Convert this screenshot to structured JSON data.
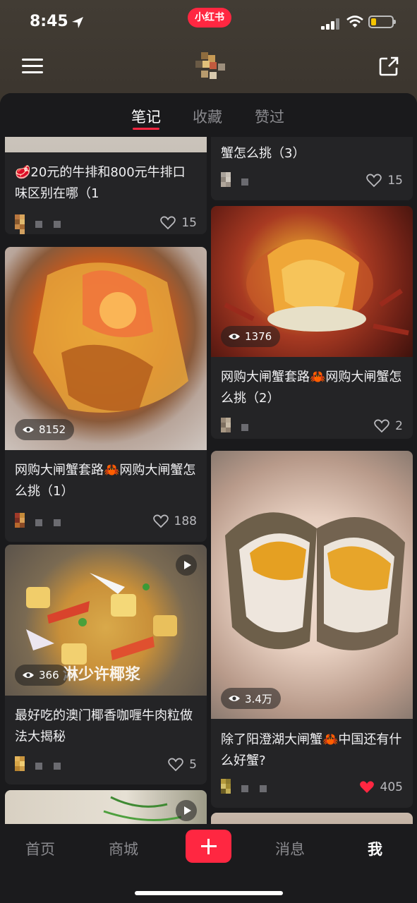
{
  "status_bar": {
    "time": "8:45",
    "app_badge": "小红书"
  },
  "tabs": [
    {
      "label": "笔记",
      "active": true
    },
    {
      "label": "收藏",
      "active": false
    },
    {
      "label": "赞过",
      "active": false
    }
  ],
  "feed": {
    "left": [
      {
        "title": "🥩20元的牛排和800元牛排口味区别在哪（1",
        "likes": "15",
        "liked": false
      },
      {
        "title": "网购大闸蟹套路🦀网购大闸蟹怎么挑（1）",
        "views": "8152",
        "likes": "188",
        "liked": false
      },
      {
        "title": "最好吃的澳门椰香咖喱牛肉粒做法大揭秘",
        "views": "366",
        "overlay_text": "淋少许椰浆",
        "likes": "5",
        "liked": false,
        "video": true
      },
      {
        "title": "",
        "likes": "",
        "video": true
      }
    ],
    "right": [
      {
        "title": "蟹怎么挑（3）",
        "likes": "15",
        "liked": false
      },
      {
        "title": "网购大闸蟹套路🦀网购大闸蟹怎么挑（2）",
        "views": "1376",
        "likes": "2",
        "liked": false
      },
      {
        "title": "除了阳澄湖大闸蟹🦀中国还有什么好蟹?",
        "views": "3.4万",
        "likes": "405",
        "liked": true
      },
      {
        "title": "",
        "likes": ""
      }
    ]
  },
  "bottom_nav": [
    {
      "label": "首页",
      "active": false
    },
    {
      "label": "商城",
      "active": false
    },
    {
      "label": "消息",
      "active": false
    },
    {
      "label": "我",
      "active": true
    }
  ],
  "colors": {
    "accent": "#ff2741",
    "background": "#1a1a1c",
    "card": "#242426",
    "header": "#3d372f"
  }
}
